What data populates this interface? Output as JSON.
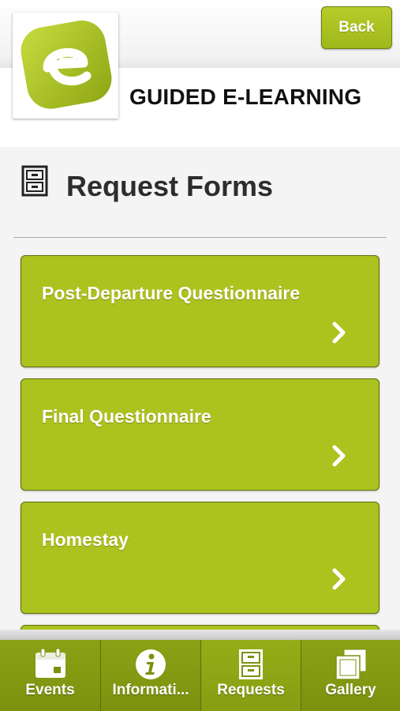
{
  "header": {
    "brand": "GUIDED E-LEARNING",
    "back_label": "Back"
  },
  "section": {
    "title": "Request Forms",
    "icon": "filing-cabinet-icon"
  },
  "list": {
    "items": [
      {
        "label": "Post-Departure Questionnaire"
      },
      {
        "label": "Final Questionnaire"
      },
      {
        "label": "Homestay"
      },
      {
        "label": ""
      }
    ]
  },
  "tabbar": {
    "tabs": [
      {
        "label": "Events",
        "icon": "calendar-icon"
      },
      {
        "label": "Informati...",
        "icon": "info-icon"
      },
      {
        "label": "Requests",
        "icon": "filing-cabinet-icon",
        "active": true
      },
      {
        "label": "Gallery",
        "icon": "photos-icon"
      }
    ]
  },
  "colors": {
    "accent": "#acc21f",
    "accent_dark": "#7c920f",
    "background": "#f4f4f4"
  }
}
